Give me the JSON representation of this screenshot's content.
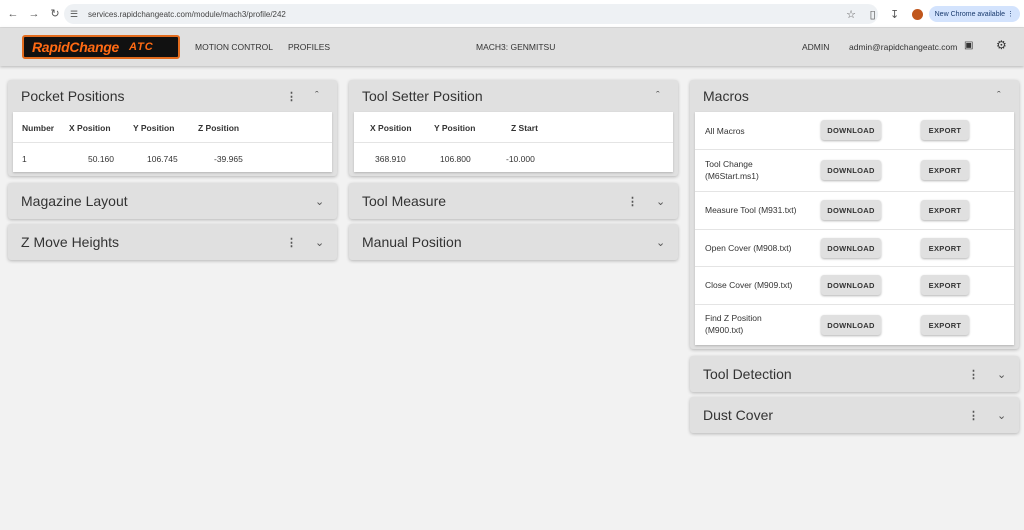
{
  "browser": {
    "url": "services.rapidchangeatc.com/module/mach3/profile/242",
    "update_label": "New Chrome available"
  },
  "header": {
    "logo_text": "RapidChange",
    "logo_suffix": "ATC",
    "nav": [
      "MOTION CONTROL",
      "PROFILES"
    ],
    "profile_title": "MACH3: GENMITSU",
    "admin_label": "ADMIN",
    "email": "admin@rapidchangeatc.com"
  },
  "pocket_positions": {
    "title": "Pocket Positions",
    "columns": [
      "Number",
      "X Position",
      "Y Position",
      "Z Position"
    ],
    "rows": [
      [
        "1",
        "50.160",
        "106.745",
        "-39.965"
      ]
    ]
  },
  "magazine_layout": {
    "title": "Magazine Layout"
  },
  "z_move_heights": {
    "title": "Z Move Heights"
  },
  "tool_setter": {
    "title": "Tool Setter Position",
    "columns": [
      "X Position",
      "Y Position",
      "Z Start"
    ],
    "rows": [
      [
        "368.910",
        "106.800",
        "-10.000"
      ]
    ]
  },
  "tool_measure": {
    "title": "Tool Measure"
  },
  "manual_position": {
    "title": "Manual Position"
  },
  "macros": {
    "title": "Macros",
    "download_label": "DOWNLOAD",
    "export_label": "EXPORT",
    "items": [
      {
        "line1": "All Macros",
        "line2": ""
      },
      {
        "line1": "Tool Change",
        "line2": "(M6Start.ms1)"
      },
      {
        "line1": "Measure Tool (M931.txt)",
        "line2": ""
      },
      {
        "line1": "Open Cover (M908.txt)",
        "line2": ""
      },
      {
        "line1": "Close Cover (M909.txt)",
        "line2": ""
      },
      {
        "line1": "Find Z Position",
        "line2": "(M900.txt)"
      }
    ]
  },
  "tool_detection": {
    "title": "Tool Detection"
  },
  "dust_cover": {
    "title": "Dust Cover"
  }
}
